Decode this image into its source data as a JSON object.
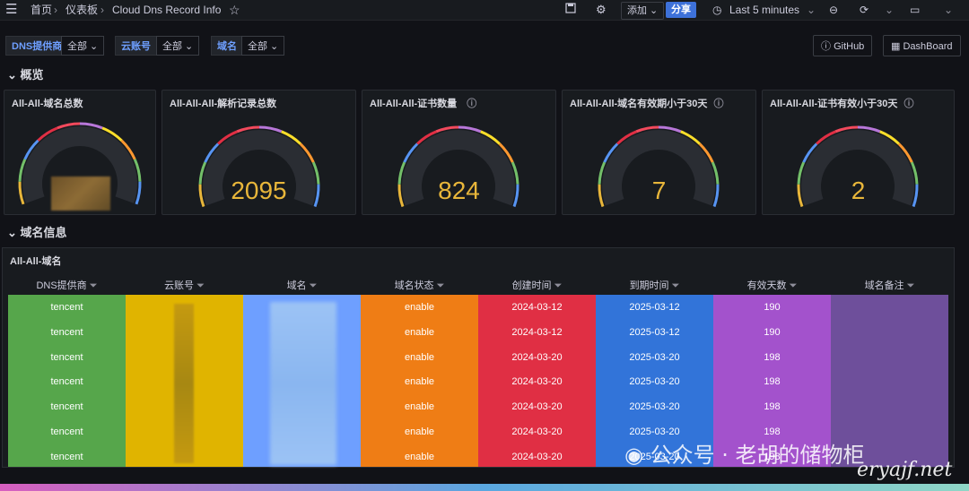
{
  "topbar": {
    "breadcrumbs": [
      "首页",
      "仪表板",
      "Cloud Dns Record Info"
    ],
    "add_label": "添加",
    "share_label": "分享",
    "time_range": "Last 5 minutes"
  },
  "filters": [
    {
      "label": "DNS提供商",
      "value": "全部"
    },
    {
      "label": "云账号",
      "value": "全部"
    },
    {
      "label": "域名",
      "value": "全部"
    }
  ],
  "links": {
    "github": "GitHub",
    "dashboard": "DashBoard"
  },
  "rows": {
    "overview": "概览",
    "domain_info": "域名信息"
  },
  "stats": [
    {
      "title": "All-All-域名总数",
      "value": "",
      "info": false
    },
    {
      "title": "All-All-All-解析记录总数",
      "value": "2095",
      "info": false
    },
    {
      "title": "All-All-All-证书数量",
      "value": "824",
      "info": true
    },
    {
      "title": "All-All-All-域名有效期小于30天",
      "value": "7",
      "info": true
    },
    {
      "title": "All-All-All-证书有效小于30天",
      "value": "2",
      "info": true
    }
  ],
  "table": {
    "title": "All-All-域名",
    "headers": [
      "DNS提供商",
      "云账号",
      "域名",
      "域名状态",
      "创建时间",
      "到期时间",
      "有效天数",
      "域名备注"
    ],
    "column_colors": [
      "#56a64b",
      "#e0b400",
      "#6e9fff",
      "#ef7d15",
      "#e02f44",
      "#3274d9",
      "#a352cc",
      "#6e4f9b"
    ],
    "rows": [
      {
        "provider": "tencent",
        "status": "enable",
        "created": "2024-03-12",
        "expires": "2025-03-12",
        "days": "190"
      },
      {
        "provider": "tencent",
        "status": "enable",
        "created": "2024-03-12",
        "expires": "2025-03-12",
        "days": "190"
      },
      {
        "provider": "tencent",
        "status": "enable",
        "created": "2024-03-20",
        "expires": "2025-03-20",
        "days": "198"
      },
      {
        "provider": "tencent",
        "status": "enable",
        "created": "2024-03-20",
        "expires": "2025-03-20",
        "days": "198"
      },
      {
        "provider": "tencent",
        "status": "enable",
        "created": "2024-03-20",
        "expires": "2025-03-20",
        "days": "198"
      },
      {
        "provider": "tencent",
        "status": "enable",
        "created": "2024-03-20",
        "expires": "2025-03-20",
        "days": "198"
      },
      {
        "provider": "tencent",
        "status": "enable",
        "created": "2024-03-20",
        "expires": "2025-03-20",
        "days": "198"
      }
    ]
  },
  "watermark": {
    "text": "公众号 · 老胡的储物柜",
    "site": "eryajf.net"
  }
}
